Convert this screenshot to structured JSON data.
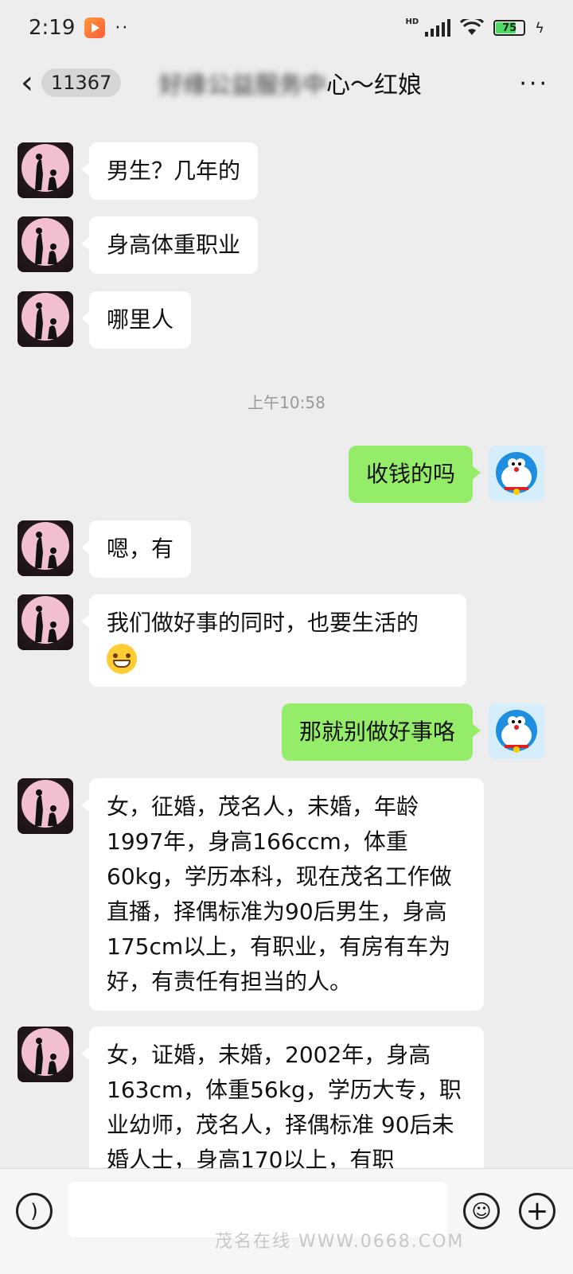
{
  "statusbar": {
    "time": "2:19",
    "dots": "··",
    "network": "HD",
    "battery": "75"
  },
  "header": {
    "unread_count": "11367",
    "title_obscured": "好缘公益服务中",
    "title_visible": "心～红娘",
    "more": "···"
  },
  "messages": [
    {
      "side": "left",
      "text": "男生？几年的"
    },
    {
      "side": "left",
      "text": "身高体重职业"
    },
    {
      "side": "left",
      "text": "哪里人"
    },
    {
      "side": "time",
      "text": "上午10:58"
    },
    {
      "side": "right",
      "text": "收钱的吗"
    },
    {
      "side": "left",
      "text": "嗯，有"
    },
    {
      "side": "left",
      "text": "我们做好事的同时，也要生活的",
      "emoji": "grin"
    },
    {
      "side": "right",
      "text": "那就别做好事咯"
    },
    {
      "side": "left",
      "text": "女，征婚，茂名人，未婚，年龄1997年，身高166ccm，体重60kg，学历本科，现在茂名工作做直播，择偶标准为90后男生，身高175cm以上，有职业，有房有车为好，有责任有担当的人。"
    },
    {
      "side": "left",
      "text": "女，证婚，未婚，2002年，身高163cm，体重56kg，学历大专，职业幼师，茂名人，择偶标准 90后未婚人士，身高170以上，有职"
    }
  ],
  "input": {
    "placeholder": ""
  },
  "watermark": "茂名在线 WWW.0668.COM"
}
